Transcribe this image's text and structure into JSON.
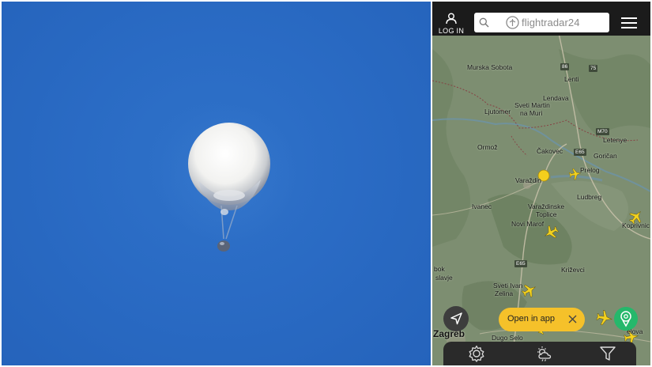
{
  "photo": {
    "subject": "balloon-photo"
  },
  "app": {
    "login_label": "LOG IN",
    "search_placeholder": "",
    "logo_text": "flightradar24"
  },
  "map": {
    "places": [
      {
        "name": "Murska Sobota"
      },
      {
        "name": "Lenti"
      },
      {
        "name": "Lendava"
      },
      {
        "name": "Sveti Martin"
      },
      {
        "name": "na Muri"
      },
      {
        "name": "Ljutomer"
      },
      {
        "name": "Letenye"
      },
      {
        "name": "Ormož"
      },
      {
        "name": "Čakovec"
      },
      {
        "name": "Goričan"
      },
      {
        "name": "Prelog"
      },
      {
        "name": "Varaždin"
      },
      {
        "name": "Ludbreg"
      },
      {
        "name": "Ivanec"
      },
      {
        "name": "Varaždinske"
      },
      {
        "name": "Toplice"
      },
      {
        "name": "Novi Marof"
      },
      {
        "name": "Koprivnic"
      },
      {
        "name": "Križevci"
      },
      {
        "name": "bok"
      },
      {
        "name": "slavje"
      },
      {
        "name": "Sveti Ivan"
      },
      {
        "name": "Zelina"
      },
      {
        "name": "Zagreb"
      },
      {
        "name": "Dugo Selo"
      },
      {
        "name": "elova"
      }
    ],
    "road_shields": [
      "86",
      "75",
      "M70",
      "E65",
      "E65"
    ]
  },
  "actions": {
    "open_app_label": "Open in app"
  },
  "colors": {
    "sky": "#2a6bc4",
    "topbar": "#1b1b1b",
    "accent_yellow": "#f5c12a",
    "pin_green": "#25b86b",
    "aircraft": "#f3d21e"
  }
}
